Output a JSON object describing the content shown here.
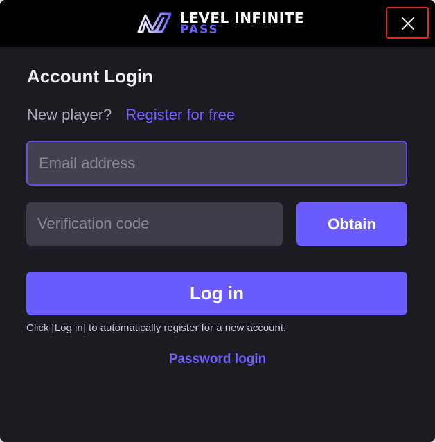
{
  "brand": {
    "line1": "LEVEL INFINITE",
    "line2": "PASS",
    "logo_icon": "level-infinite-logo",
    "accent_color": "#6a5cff"
  },
  "close": {
    "icon": "close-icon"
  },
  "form": {
    "title": "Account Login",
    "new_player_text": "New player?",
    "register_link": "Register for free",
    "email_placeholder": "Email address",
    "code_placeholder": "Verification code",
    "obtain_label": "Obtain",
    "login_label": "Log in",
    "hint": "Click [Log in] to automatically register for a new account.",
    "password_login": "Password login"
  }
}
